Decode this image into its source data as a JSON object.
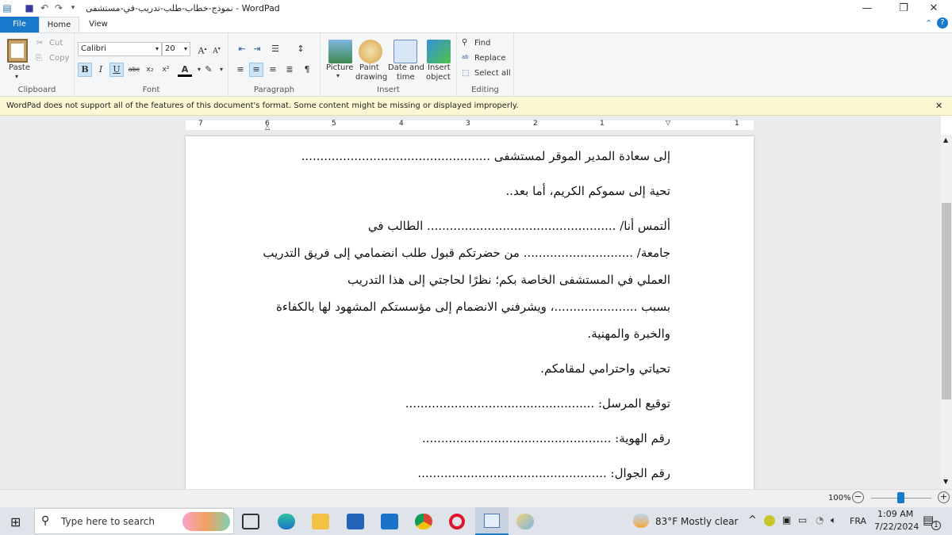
{
  "window": {
    "title": "نموذج-خطاب-طلب-تدريب-في-مستشفى - WordPad"
  },
  "tabs": [
    {
      "label": "File"
    },
    {
      "label": "Home"
    },
    {
      "label": "View"
    }
  ],
  "ribbon": {
    "clipboard": {
      "label": "Clipboard",
      "paste": "Paste",
      "cut": "Cut",
      "copy": "Copy"
    },
    "font": {
      "label": "Font",
      "family": "Calibri",
      "size": "20"
    },
    "paragraph": {
      "label": "Paragraph"
    },
    "insert": {
      "label": "Insert",
      "picture": "Picture",
      "paint1": "Paint",
      "paint2": "drawing",
      "date1": "Date and",
      "date2": "time",
      "obj1": "Insert",
      "obj2": "object"
    },
    "editing": {
      "label": "Editing",
      "find": "Find",
      "replace": "Replace",
      "select_all": "Select all"
    }
  },
  "warning": "WordPad does not support all of the features of this document's format. Some content might be missing or displayed improperly.",
  "ruler": [
    "7",
    "6",
    "5",
    "4",
    "3",
    "2",
    "1",
    "1"
  ],
  "document": {
    "lines": [
      "إلى سعادة المدير الموقر لمستشفى ..................................................",
      "تحية إلى سموكم الكريم، أما بعد..",
      "ألتمس أنا/ .................................................. الطالب في",
      "جامعة/ ............................. من حضرتكم قبول طلب انضمامي إلى فريق التدريب",
      "العملي في المستشفى الخاصة بكم؛ نظرًا لحاجتي إلى هذا التدريب",
      "بسبب ......................، ويشرفني الانضمام إلى مؤسستكم المشهود لها بالكفاءة",
      "والخبرة والمهنية.",
      "تحياتي واحترامي لمقامكم.",
      "توقيع المرسل: ..................................................",
      "رقم الهوية: ..................................................",
      "رقم الجوال: .................................................."
    ]
  },
  "status": {
    "zoom": "100%"
  },
  "taskbar": {
    "search_placeholder": "Type here to search",
    "weather": "83°F  Mostly clear",
    "lang": "FRA",
    "time": "1:09 AM",
    "date": "7/22/2024",
    "notif": "1"
  }
}
